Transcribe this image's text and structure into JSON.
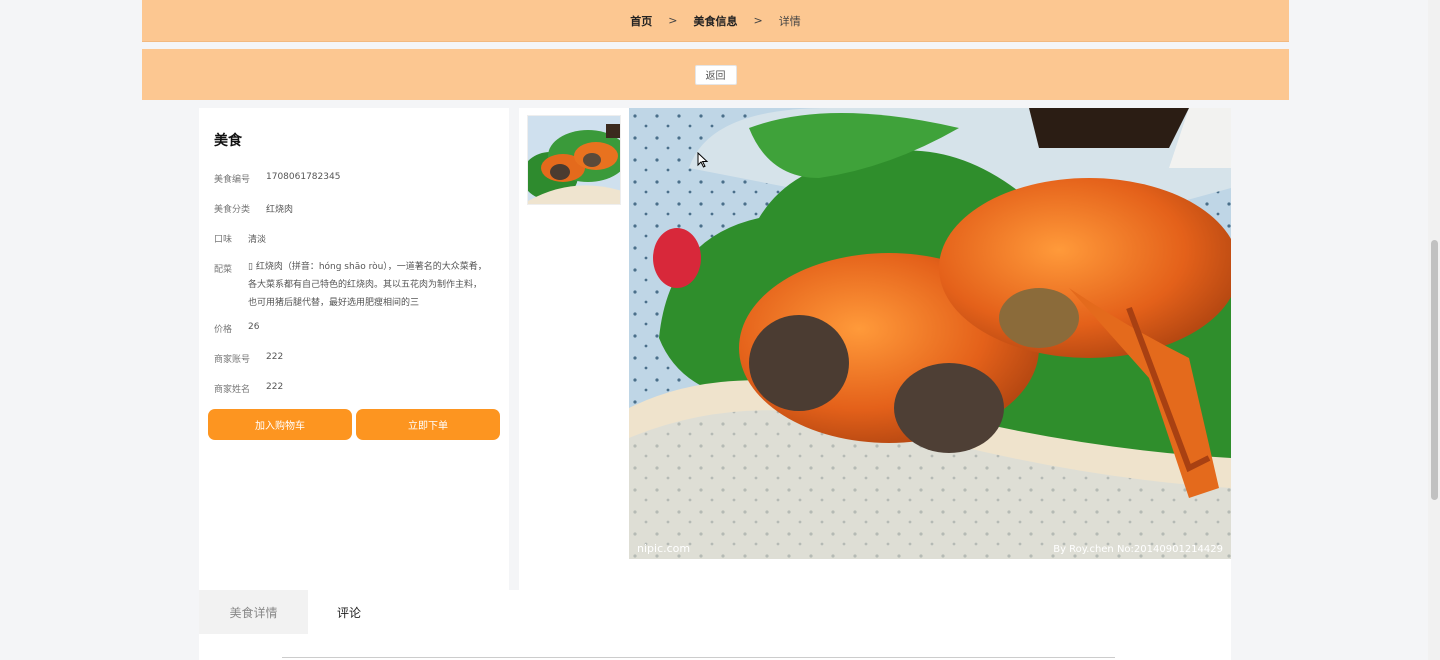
{
  "breadcrumb": {
    "home": "首页",
    "sep1": ">",
    "info": "美食信息",
    "sep2": ">",
    "current": "详情"
  },
  "back_label": "返回",
  "food": {
    "title": "美食",
    "fields": [
      {
        "label": "美食编号",
        "value": "1708061782345"
      },
      {
        "label": "美食分类",
        "value": "红烧肉"
      },
      {
        "label": "口味",
        "value": "清淡"
      },
      {
        "label": "配菜",
        "value": "▯ 红烧肉（拼音：hóng shāo ròu），一道著名的大众菜肴，各大菜系都有自己特色的红烧肉。其以五花肉为制作主料，也可用猪后腿代替，最好选用肥瘦相间的三"
      },
      {
        "label": "价格",
        "value": "26"
      },
      {
        "label": "商家账号",
        "value": "222"
      },
      {
        "label": "商家姓名",
        "value": "222"
      }
    ],
    "add_cart_label": "加入购物车",
    "order_label": "立即下单"
  },
  "image": {
    "watermark_left": "nipic.com",
    "watermark_right": "By Roy.chen No:20140901214429"
  },
  "tabs": [
    {
      "label": "美食详情"
    },
    {
      "label": "评论"
    }
  ],
  "colors": {
    "header_bg": "#fcc791",
    "button_orange": "#fd9520"
  }
}
